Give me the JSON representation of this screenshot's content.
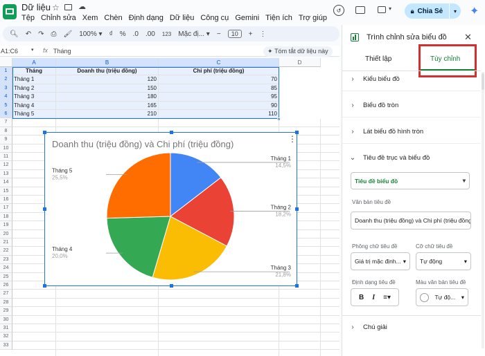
{
  "doc": {
    "title": "Dữ liệu",
    "menus": [
      "Tệp",
      "Chỉnh sửa",
      "Xem",
      "Chèn",
      "Định dạng",
      "Dữ liệu",
      "Công cụ",
      "Gemini",
      "Tiện ích",
      "Trợ giúp"
    ],
    "share_label": "Chia Sẻ"
  },
  "toolbar": {
    "zoom": "100%",
    "currency": "₫",
    "percent": "%",
    "dec_dec": ".0",
    "dec_inc": ".00",
    "format_123": "123",
    "font": "Mặc đị...",
    "font_size": "10",
    "minus": "−",
    "plus": "+"
  },
  "formula": {
    "namebox": "A1:C6",
    "fx": "fx",
    "content": "Tháng",
    "summarize": "Tóm tắt dữ liệu này"
  },
  "sheet": {
    "columns": [
      "A",
      "B",
      "C",
      "D"
    ],
    "rows": [
      "1",
      "2",
      "3",
      "4",
      "5",
      "6",
      "7",
      "8",
      "9",
      "10",
      "11",
      "12",
      "13",
      "14",
      "15",
      "16",
      "17",
      "18",
      "19",
      "20",
      "21",
      "22",
      "23",
      "24",
      "25",
      "26",
      "27",
      "28",
      "29",
      "30",
      "31",
      "32",
      "33"
    ],
    "headers": [
      "Tháng",
      "Doanh thu (triệu đồng)",
      "Chi phí (triệu đồng)"
    ],
    "data": [
      [
        "Tháng 1",
        "120",
        "70"
      ],
      [
        "Tháng 2",
        "150",
        "85"
      ],
      [
        "Tháng 3",
        "180",
        "95"
      ],
      [
        "Tháng 4",
        "165",
        "90"
      ],
      [
        "Tháng 5",
        "210",
        "110"
      ]
    ]
  },
  "chart_data": {
    "type": "pie",
    "title": "Doanh thu (triệu đồng) và Chi phí (triệu đồng)",
    "categories": [
      "Tháng 1",
      "Tháng 2",
      "Tháng 3",
      "Tháng 4",
      "Tháng 5"
    ],
    "values": [
      120,
      150,
      180,
      165,
      210
    ],
    "percent_labels": [
      "14,5%",
      "18,2%",
      "21,8%",
      "20,0%",
      "25,5%"
    ],
    "colors": [
      "#4285f4",
      "#ea4335",
      "#fbbc04",
      "#34a853",
      "#ff6d01"
    ],
    "legend": "labels-outside"
  },
  "panel": {
    "title": "Trình chỉnh sửa biểu đồ",
    "tabs": [
      "Thiết lập",
      "Tùy chỉnh"
    ],
    "active_tab": "Tùy chỉnh",
    "sections": [
      "Kiểu biểu đồ",
      "Biểu đồ tròn",
      "Lát biểu đồ hình tròn",
      "Tiêu đề trục và biểu đồ",
      "Chú giải"
    ],
    "title_select": "Tiêu đề biểu đồ",
    "title_text_label": "Văn bản tiêu đề",
    "title_text_value": "Doanh thu (triệu đồng) và Chi phí (triệu đồng)",
    "font_label": "Phông chữ tiêu đề",
    "font_value": "Giá trị mặc định...",
    "size_label": "Cỡ chữ tiêu đề",
    "size_value": "Tự động",
    "format_label": "Định dạng tiêu đề",
    "color_label": "Màu văn bản tiêu đề",
    "color_value": "Tự độ...",
    "bold": "B",
    "italic": "I",
    "highlight_color": "#d32f2f"
  }
}
